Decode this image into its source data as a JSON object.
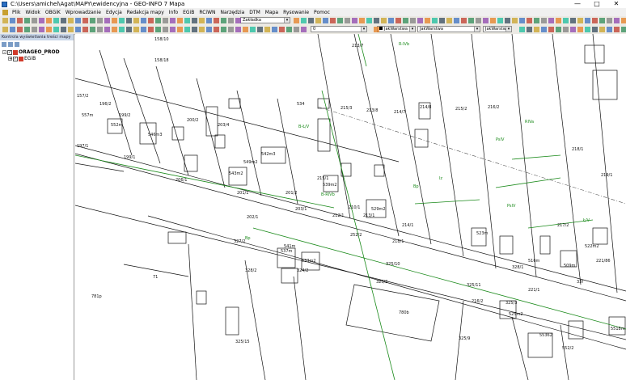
{
  "window": {
    "title": "C:\\Users\\amichel\\Agat\\MAPY\\ewidencyjna - GEO-INFO 7 Mapa",
    "minimize": "—",
    "maximize": "□",
    "close": "✕"
  },
  "menu": [
    "Plik",
    "Widok",
    "OBGiK",
    "Wprowadzanie",
    "Edycja",
    "Redakcja mapy",
    "Info",
    "EGiB",
    "RCiWN",
    "Narzędzia",
    "DTM",
    "Mapa",
    "Rysowanie",
    "Pomoc"
  ],
  "toolbar": {
    "scale_combo": "Zakładka",
    "layer_combo": "0",
    "color_combo": "JakWarstwa",
    "style_combo": "JakWarstwa",
    "weight_combo": "JakWarstwa"
  },
  "panel": {
    "title": "Kontrola wyświetlania treści mapy",
    "tree": [
      {
        "expander": "-",
        "label": "ORAGEO_PROD"
      },
      {
        "expander": "+",
        "label": "EGiB"
      }
    ]
  },
  "map_labels": [
    {
      "t": "158/10",
      "c": "b"
    },
    {
      "t": "158/18",
      "c": "b"
    },
    {
      "t": "157/2",
      "c": "b"
    },
    {
      "t": "557m",
      "c": "b"
    },
    {
      "t": "196/2",
      "c": "b"
    },
    {
      "t": "552m",
      "c": "b"
    },
    {
      "t": "199/2",
      "c": "b"
    },
    {
      "t": "546m3",
      "c": "b"
    },
    {
      "t": "200/2",
      "c": "b"
    },
    {
      "t": "203/4",
      "c": "b"
    },
    {
      "t": "534",
      "c": "b"
    },
    {
      "t": "213/7",
      "c": "b"
    },
    {
      "t": "R-IVb",
      "c": "g"
    },
    {
      "t": "214/7",
      "c": "b"
    },
    {
      "t": "214/8",
      "c": "b"
    },
    {
      "t": "215/2",
      "c": "b"
    },
    {
      "t": "216/2",
      "c": "b"
    },
    {
      "t": "RIVa",
      "c": "g"
    },
    {
      "t": "PsIV",
      "c": "g"
    },
    {
      "t": "218/1",
      "c": "b"
    },
    {
      "t": "215/3",
      "c": "b"
    },
    {
      "t": "213/8",
      "c": "b"
    },
    {
      "t": "B-Ł/V",
      "c": "g"
    },
    {
      "t": "542m3",
      "c": "b"
    },
    {
      "t": "543m2",
      "c": "b"
    },
    {
      "t": "549m2",
      "c": "b"
    },
    {
      "t": "201/1",
      "c": "b"
    },
    {
      "t": "206/1",
      "c": "b"
    },
    {
      "t": "197/1",
      "c": "b"
    },
    {
      "t": "199/1",
      "c": "b"
    },
    {
      "t": "539m2",
      "c": "b"
    },
    {
      "t": "B-RIVb",
      "c": "g"
    },
    {
      "t": "529m2",
      "c": "b"
    },
    {
      "t": "Bp",
      "c": "g"
    },
    {
      "t": "lz",
      "c": "g"
    },
    {
      "t": "PsIV",
      "c": "g"
    },
    {
      "t": "217/2",
      "c": "b"
    },
    {
      "t": "Ł/V",
      "c": "g"
    },
    {
      "t": "219/1",
      "c": "b"
    },
    {
      "t": "201/2",
      "c": "b"
    },
    {
      "t": "202/1",
      "c": "b"
    },
    {
      "t": "203/1",
      "c": "b"
    },
    {
      "t": "212/1",
      "c": "b"
    },
    {
      "t": "210/1",
      "c": "b"
    },
    {
      "t": "213/1",
      "c": "b"
    },
    {
      "t": "214/1",
      "c": "b"
    },
    {
      "t": "327/2",
      "c": "b"
    },
    {
      "t": "Bp",
      "c": "g"
    },
    {
      "t": "541m",
      "c": "b"
    },
    {
      "t": "533m2",
      "c": "b"
    },
    {
      "t": "537m",
      "c": "b"
    },
    {
      "t": "252/2",
      "c": "b"
    },
    {
      "t": "218/1",
      "c": "b"
    },
    {
      "t": "523m",
      "c": "b"
    },
    {
      "t": "516m",
      "c": "b"
    },
    {
      "t": "509m",
      "c": "b"
    },
    {
      "t": "221/86",
      "c": "b"
    },
    {
      "t": "325/10",
      "c": "b"
    },
    {
      "t": "328/2",
      "c": "b"
    },
    {
      "t": "324/2",
      "c": "b"
    },
    {
      "t": "325/2",
      "c": "b"
    },
    {
      "t": "325/11",
      "c": "b"
    },
    {
      "t": "781p",
      "c": "b"
    },
    {
      "t": "71",
      "c": "b"
    },
    {
      "t": "780b",
      "c": "b"
    },
    {
      "t": "325/9",
      "c": "b"
    },
    {
      "t": "325/15",
      "c": "b"
    },
    {
      "t": "525m2",
      "c": "b"
    },
    {
      "t": "55362",
      "c": "b"
    },
    {
      "t": "552/2",
      "c": "b"
    },
    {
      "t": "5518m",
      "c": "b"
    },
    {
      "t": "221/1",
      "c": "b"
    },
    {
      "t": "33f",
      "c": "b"
    },
    {
      "t": "216/2",
      "c": "b"
    },
    {
      "t": "325/3",
      "c": "b"
    },
    {
      "t": "522m2",
      "c": "b"
    },
    {
      "t": "328/1",
      "c": "b"
    },
    {
      "t": "215/1",
      "c": "b"
    }
  ],
  "colors": {
    "lines": "#111111",
    "greenline": "#1a8a1a",
    "title_bg": "#ffffff",
    "toolbar_bg": "#eceae4",
    "panel_header": "#c8d6e8"
  }
}
